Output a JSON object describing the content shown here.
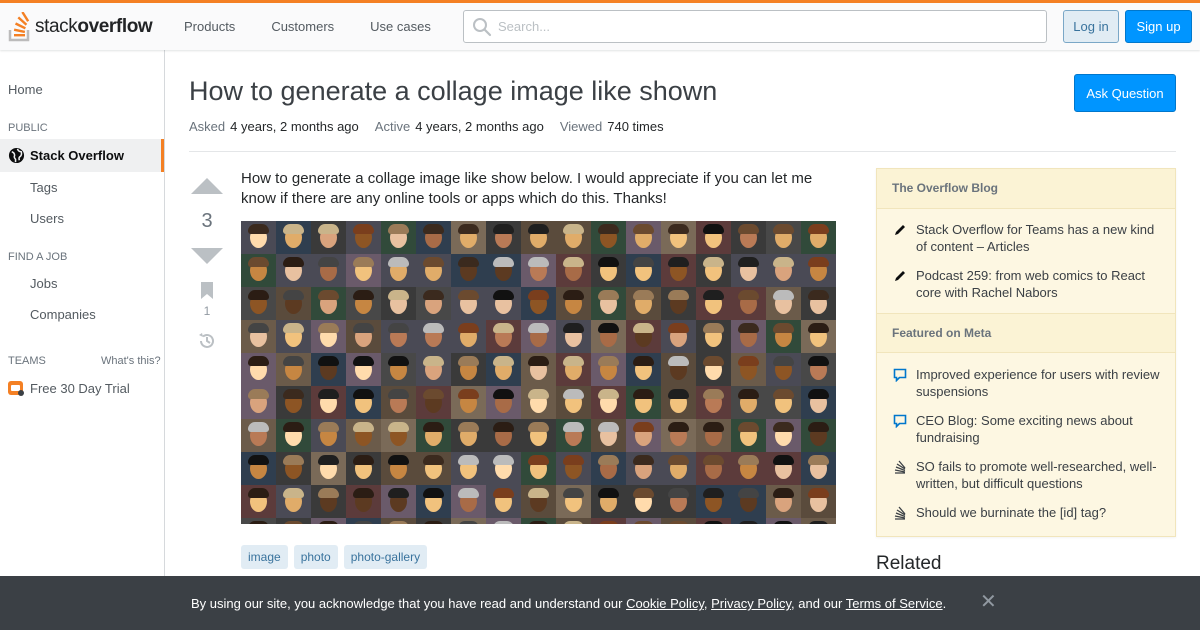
{
  "header": {
    "logo_text_light": "stack",
    "logo_text_bold": "overflow",
    "nav": [
      "Products",
      "Customers",
      "Use cases"
    ],
    "search_placeholder": "Search...",
    "login_label": "Log in",
    "signup_label": "Sign up"
  },
  "sidebar": {
    "home": "Home",
    "public_label": "PUBLIC",
    "active_item": "Stack Overflow",
    "public_items": [
      "Tags",
      "Users"
    ],
    "find_job_label": "FIND A JOB",
    "job_items": [
      "Jobs",
      "Companies"
    ],
    "teams_label": "TEAMS",
    "whats_this": "What's this?",
    "trial": "Free 30 Day Trial"
  },
  "question": {
    "title": "How to generate a collage image like shown",
    "ask_button": "Ask Question",
    "asked_label": "Asked",
    "asked_value": "4 years, 2 months ago",
    "active_label": "Active",
    "active_value": "4 years, 2 months ago",
    "viewed_label": "Viewed",
    "viewed_value": "740 times",
    "votes": "3",
    "bookmarks": "1",
    "body": "How to generate a collage image like show below. I would appreciate if you can let me know if there are any online tools or apps which do this. Thanks!",
    "tags": [
      "image",
      "photo",
      "photo-gallery"
    ]
  },
  "right_sidebar": {
    "blog_title": "The Overflow Blog",
    "blog_items": [
      "Stack Overflow for Teams has a new kind of content – Articles",
      "Podcast 259: from web comics to React core with Rachel Nabors"
    ],
    "meta_title": "Featured on Meta",
    "meta_items": [
      "Improved experience for users with review suspensions",
      "CEO Blog: Some exciting news about fundraising",
      "SO fails to promote well-researched, well-written, but difficult questions",
      "Should we burninate the [id] tag?"
    ],
    "related_title": "Related"
  },
  "cookie": {
    "prefix": "By using our site, you acknowledge that you have read and understand our ",
    "cookie_policy": "Cookie Policy",
    "sep1": ", ",
    "privacy_policy": "Privacy Policy",
    "sep2": ", and our ",
    "terms": "Terms of Service",
    "suffix": ".",
    "close": "✕"
  },
  "colors": {
    "accent_orange": "#f48024",
    "primary_blue": "#0095ff",
    "tag_bg": "#e1ecf4",
    "blog_bg": "#fdf7e2"
  }
}
